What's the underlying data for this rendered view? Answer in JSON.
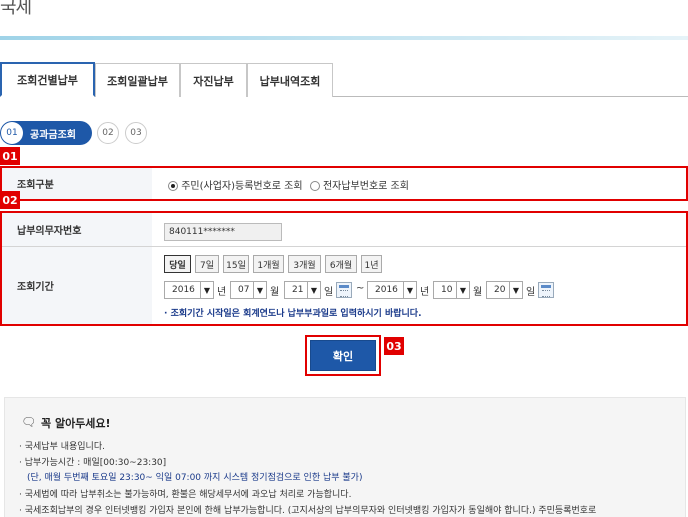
{
  "page": {
    "title": "국세"
  },
  "tabs": [
    {
      "label": "조회건별납부",
      "active": true
    },
    {
      "label": "조회일괄납부",
      "active": false
    },
    {
      "label": "자진납부",
      "active": false
    },
    {
      "label": "납부내역조회",
      "active": false
    }
  ],
  "steps": {
    "first_num": "01",
    "first_label": "공과금조회",
    "second": "02",
    "third": "03"
  },
  "badges": {
    "b1": "01",
    "b2": "02",
    "b3": "03"
  },
  "inquiry_type": {
    "label": "조회구분",
    "option1": "주민(사업자)등록번호로 조회",
    "option2": "전자납부번호로 조회",
    "selected": "option1"
  },
  "taxpayer": {
    "label": "납부의무자번호",
    "value": "840111*******"
  },
  "period": {
    "label": "조회기간",
    "buttons": [
      "당일",
      "7일",
      "15일",
      "1개월",
      "3개월",
      "6개월",
      "1년"
    ],
    "start": {
      "year": "2016",
      "month": "07",
      "day": "21"
    },
    "end": {
      "year": "2016",
      "month": "10",
      "day": "20"
    },
    "unit_year": "년",
    "unit_month": "월",
    "unit_day": "일",
    "tilde": "~",
    "note": "조회기간 시작일은 회계연도나 납부부과일로 입력하시기 바랍니다."
  },
  "confirm": {
    "label": "확인"
  },
  "notice": {
    "title": "꼭 알아두세요!",
    "items": [
      "국세납부 내용입니다.",
      "납부가능시간 : 매일[00:30~23:30]",
      "(단, 매월 두번째 토요일 23:30~ 익일 07:00 까지 시스템 정기점검으로 인한 납부 불가)",
      "국세법에 따라 납부취소는 불가능하며, 환불은 해당세무서에 과오납 처리로 가능합니다.",
      "국세조회납부의 경우 인터넷뱅킹 가입자 본인에 한해 납부가능합니다. (고지서상의 납부의무자와 인터넷뱅킹 가입자가 동일해야 합니다.) 주민등록번호로"
    ]
  }
}
